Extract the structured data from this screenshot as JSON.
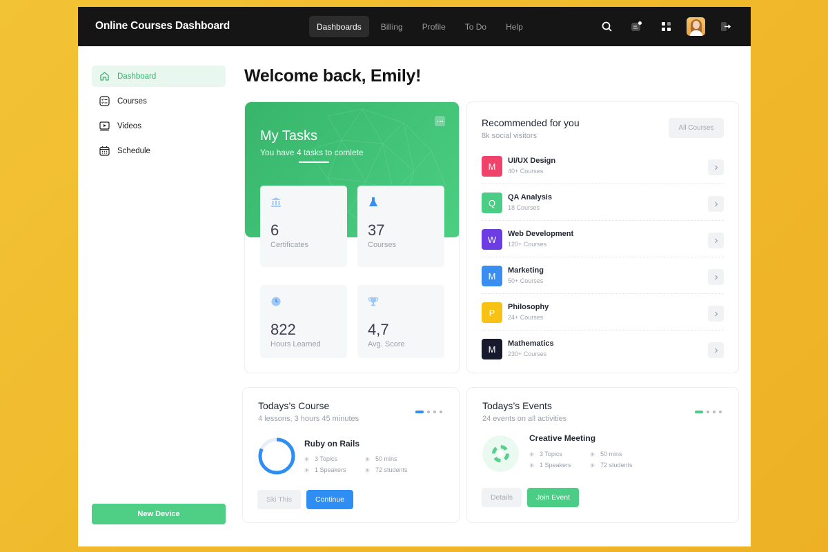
{
  "app": {
    "title": "Online Courses Dashboard"
  },
  "nav": {
    "items": [
      {
        "label": "Dashboards",
        "active": true
      },
      {
        "label": "Billing"
      },
      {
        "label": "Profile"
      },
      {
        "label": "To Do"
      },
      {
        "label": "Help"
      }
    ]
  },
  "header_icons": [
    "search-icon",
    "notification-icon",
    "apps-grid-icon",
    "user-avatar",
    "logout-icon"
  ],
  "sidebar": {
    "items": [
      {
        "label": "Dashboard",
        "icon": "home-icon",
        "active": true
      },
      {
        "label": "Courses",
        "icon": "list-icon"
      },
      {
        "label": "Videos",
        "icon": "video-icon"
      },
      {
        "label": "Schedule",
        "icon": "calendar-icon"
      }
    ],
    "new_device_label": "New Device"
  },
  "welcome": "Welcome back, Emily!",
  "tasks": {
    "title": "My Tasks",
    "subtitle": "You have 4 tasks to comlete",
    "stats": [
      {
        "value": "6",
        "label": "Certificates",
        "icon": "bank-icon"
      },
      {
        "value": "37",
        "label": "Courses",
        "icon": "flask-icon"
      },
      {
        "value": "822",
        "label": "Hours Learned",
        "icon": "clock-icon"
      },
      {
        "value": "4,7",
        "label": "Avg. Score",
        "icon": "trophy-icon"
      }
    ]
  },
  "recommended": {
    "title": "Recommended for you",
    "subtitle": "8k social visitors",
    "all_courses_label": "All Courses",
    "items": [
      {
        "letter": "M",
        "name": "UI/UX Design",
        "count": "40+ Courses",
        "color": "#f0436b"
      },
      {
        "letter": "Q",
        "name": "QA Analysis",
        "count": "18 Courses",
        "color": "#4ccd85"
      },
      {
        "letter": "W",
        "name": "Web Development",
        "count": "120+ Courses",
        "color": "#6b3de3"
      },
      {
        "letter": "M",
        "name": "Marketing",
        "count": "50+ Courses",
        "color": "#3a8ef0"
      },
      {
        "letter": "P",
        "name": "Philosophy",
        "count": "24+ Courses",
        "color": "#f7c213"
      },
      {
        "letter": "M",
        "name": "Mathematics",
        "count": "230+ Courses",
        "color": "#161a2c"
      }
    ]
  },
  "todays_course": {
    "title": "Todays’s Course",
    "subtitle": "4 lessons, 3 hours 45 minutes",
    "course_name": "Ruby on Rails",
    "progress": 0.82,
    "meta": [
      "3 Topics",
      "50 mins",
      "1 Speakers",
      "72 students"
    ],
    "skip_label": "Ski This",
    "continue_label": "Continue",
    "accent": "#2e8ef3"
  },
  "todays_events": {
    "title": "Todays’s Events",
    "subtitle": "24 events on all activities",
    "event_name": "Creative Meeting",
    "meta": [
      "3 Topics",
      "50 mins",
      "1 Speakers",
      "72 students"
    ],
    "details_label": "Details",
    "join_label": "Join Event",
    "accent": "#4ccd85"
  }
}
